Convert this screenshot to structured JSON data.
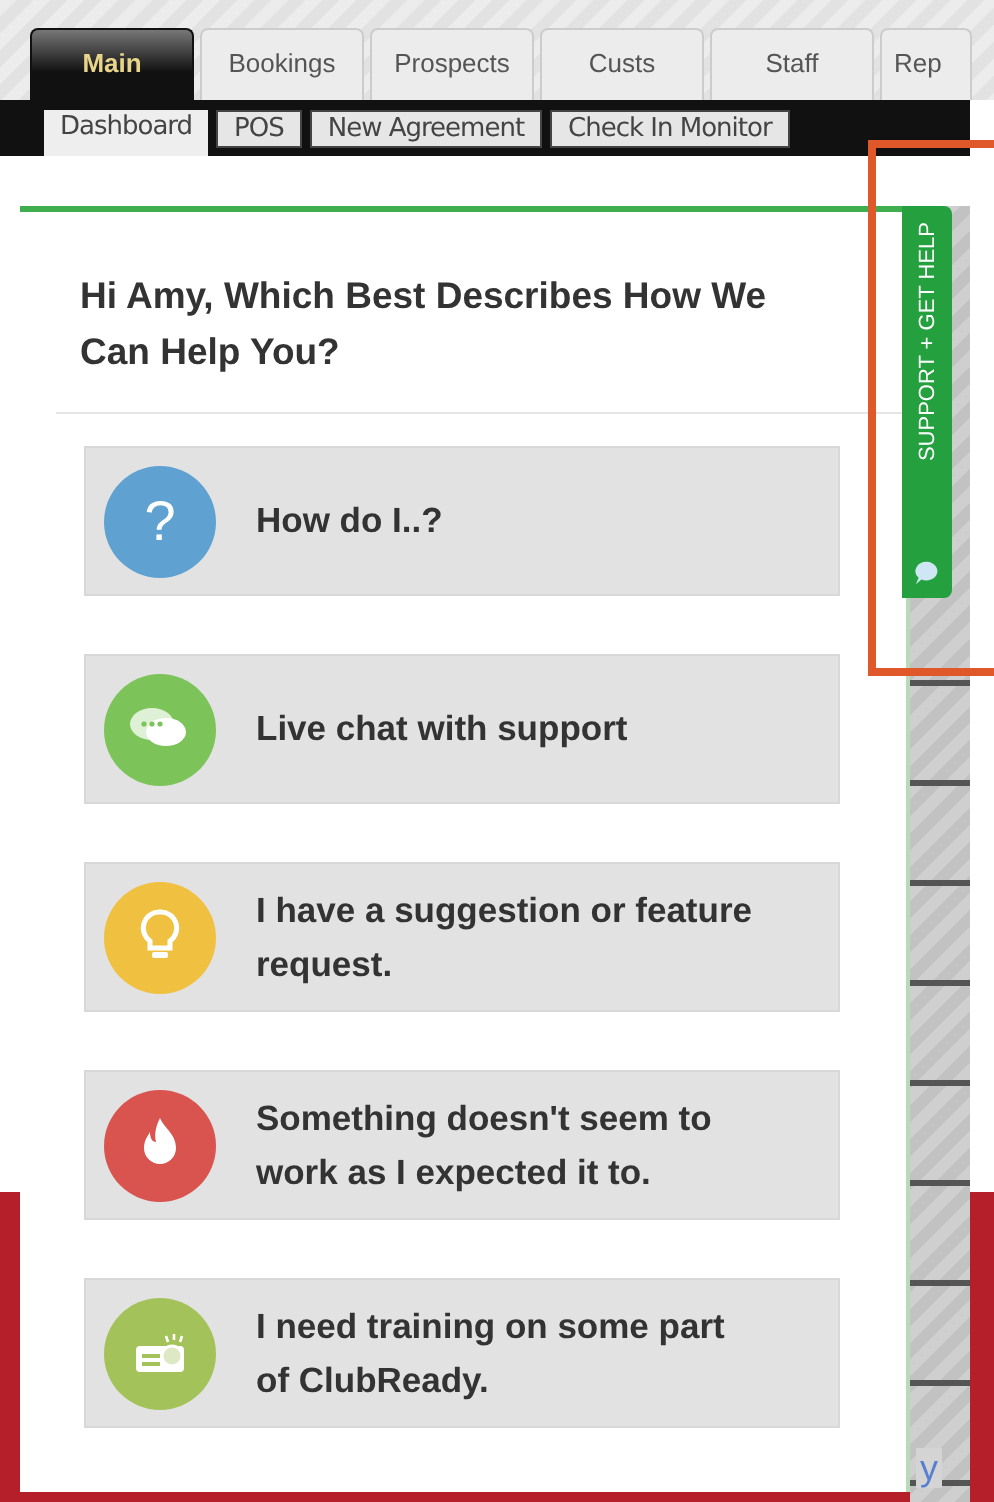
{
  "tabs": [
    {
      "label": "Main",
      "selected": true
    },
    {
      "label": "Bookings",
      "selected": false
    },
    {
      "label": "Prospects",
      "selected": false
    },
    {
      "label": "Custs",
      "selected": false
    },
    {
      "label": "Staff",
      "selected": false
    },
    {
      "label": "Rep",
      "selected": false
    }
  ],
  "subtabs": [
    {
      "label": "Dashboard",
      "selected": true
    },
    {
      "label": "POS",
      "selected": false
    },
    {
      "label": "New Agreement",
      "selected": false
    },
    {
      "label": "Check In Monitor",
      "selected": false
    }
  ],
  "help_panel": {
    "heading": "Hi Amy, Which Best Describes How We Can Help You?",
    "options": [
      {
        "kind": "question",
        "glyph": "?",
        "color": "#5fa1d0",
        "label": "How do I..?"
      },
      {
        "kind": "chat",
        "color": "#7cc45a",
        "label": "Live chat with support"
      },
      {
        "kind": "idea",
        "color": "#f0c040",
        "label": "I have a suggestion or feature request."
      },
      {
        "kind": "bug",
        "color": "#d9534f",
        "label": "Something doesn't seem to work as I expected it to."
      },
      {
        "kind": "training",
        "color": "#a3c35a",
        "label": "I need training on some part of ClubReady."
      }
    ]
  },
  "support_tab": {
    "label": "SUPPORT + GET HELP"
  },
  "background_link": "y"
}
